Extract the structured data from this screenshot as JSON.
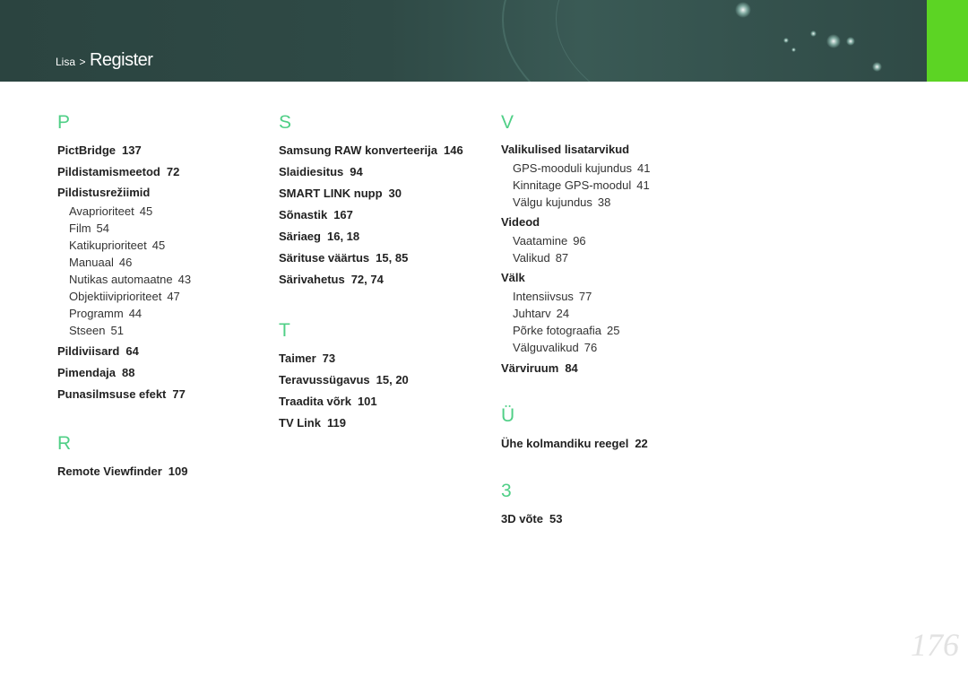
{
  "header": {
    "breadcrumb_parent": "Lisa",
    "breadcrumb_sep": ">",
    "breadcrumb_current": "Register"
  },
  "columns": [
    {
      "groups": [
        {
          "letter": "P",
          "entries": [
            {
              "label": "PictBridge",
              "page": "137"
            },
            {
              "label": "Pildistamismeetod",
              "page": "72"
            },
            {
              "label": "Pildistusrežiimid",
              "page": "",
              "subs": [
                {
                  "label": "Avaprioriteet",
                  "page": "45"
                },
                {
                  "label": "Film",
                  "page": "54"
                },
                {
                  "label": "Katikuprioriteet",
                  "page": "45"
                },
                {
                  "label": "Manuaal",
                  "page": "46"
                },
                {
                  "label": "Nutikas automaatne",
                  "page": "43"
                },
                {
                  "label": "Objektiiviprioriteet",
                  "page": "47"
                },
                {
                  "label": "Programm",
                  "page": "44"
                },
                {
                  "label": "Stseen",
                  "page": "51"
                }
              ]
            },
            {
              "label": "Pildiviisard",
              "page": "64"
            },
            {
              "label": "Pimendaja",
              "page": "88"
            },
            {
              "label": "Punasilmsuse efekt",
              "page": "77"
            }
          ]
        },
        {
          "letter": "R",
          "entries": [
            {
              "label": "Remote Viewfinder",
              "page": "109"
            }
          ]
        }
      ]
    },
    {
      "groups": [
        {
          "letter": "S",
          "entries": [
            {
              "label": "Samsung RAW konverteerija",
              "page": "146"
            },
            {
              "label": "Slaidiesitus",
              "page": "94"
            },
            {
              "label": "SMART LINK nupp",
              "page": "30"
            },
            {
              "label": "Sõnastik",
              "page": "167"
            },
            {
              "label": "Säriaeg",
              "page": "16, 18"
            },
            {
              "label": "Särituse väärtus",
              "page": "15, 85"
            },
            {
              "label": "Särivahetus",
              "page": "72, 74"
            }
          ]
        },
        {
          "letter": "T",
          "entries": [
            {
              "label": "Taimer",
              "page": "73"
            },
            {
              "label": "Teravussügavus",
              "page": "15, 20"
            },
            {
              "label": "Traadita võrk",
              "page": "101"
            },
            {
              "label": "TV Link",
              "page": "119"
            }
          ]
        }
      ]
    },
    {
      "groups": [
        {
          "letter": "V",
          "entries": [
            {
              "label": "Valikulised lisatarvikud",
              "page": "",
              "subs": [
                {
                  "label": "GPS-mooduli kujundus",
                  "page": "41"
                },
                {
                  "label": "Kinnitage GPS-moodul",
                  "page": "41"
                },
                {
                  "label": "Välgu kujundus",
                  "page": "38"
                }
              ]
            },
            {
              "label": "Videod",
              "page": "",
              "subs": [
                {
                  "label": "Vaatamine",
                  "page": "96"
                },
                {
                  "label": "Valikud",
                  "page": "87"
                }
              ]
            },
            {
              "label": "Välk",
              "page": "",
              "subs": [
                {
                  "label": "Intensiivsus",
                  "page": "77"
                },
                {
                  "label": "Juhtarv",
                  "page": "24"
                },
                {
                  "label": "Põrke fotograafia",
                  "page": "25"
                },
                {
                  "label": "Välguvalikud",
                  "page": "76"
                }
              ]
            },
            {
              "label": "Värviruum",
              "page": "84"
            }
          ]
        },
        {
          "letter": "Ü",
          "entries": [
            {
              "label": "Ühe kolmandiku reegel",
              "page": "22"
            }
          ]
        },
        {
          "letter": "3",
          "entries": [
            {
              "label": "3D võte",
              "page": "53"
            }
          ]
        }
      ]
    }
  ],
  "page_number": "176"
}
